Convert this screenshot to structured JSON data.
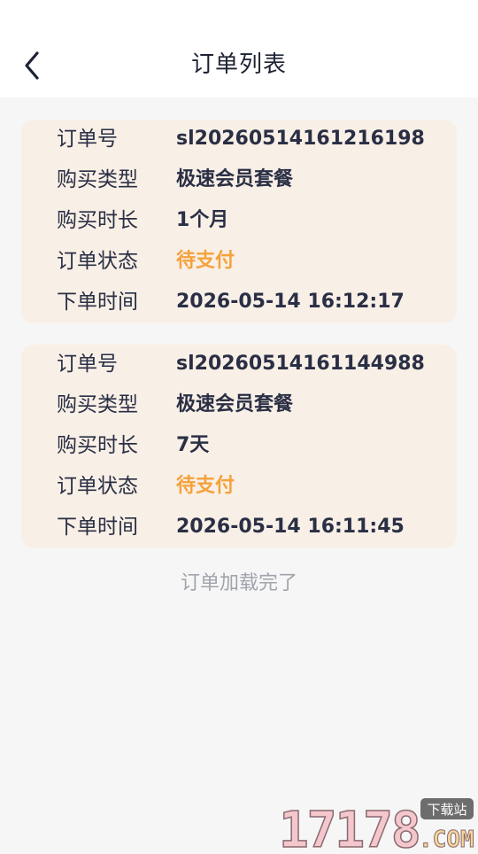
{
  "header": {
    "title": "订单列表"
  },
  "orders": [
    {
      "rows": [
        {
          "label": "订单号",
          "value": "sl20260514161216198"
        },
        {
          "label": "购买类型",
          "value": "极速会员套餐"
        },
        {
          "label": "购买时长",
          "value": "1个月"
        },
        {
          "label": "订单状态",
          "value": "待支付"
        },
        {
          "label": "下单时间",
          "value": "2026-05-14 16:12:17"
        }
      ]
    },
    {
      "rows": [
        {
          "label": "订单号",
          "value": "sl20260514161144988"
        },
        {
          "label": "购买类型",
          "value": "极速会员套餐"
        },
        {
          "label": "购买时长",
          "value": "7天"
        },
        {
          "label": "订单状态",
          "value": "待支付"
        },
        {
          "label": "下单时间",
          "value": "2026-05-14 16:11:45"
        }
      ]
    }
  ],
  "footer": {
    "note": "订单加载完了"
  },
  "watermark": {
    "brand": "17178",
    "suffix": ".COM",
    "tag": "下载站"
  },
  "colors": {
    "status_pending": "#f5a13a",
    "card_bg": "#f8efe6",
    "page_bg": "#f6f6f6"
  },
  "icons": {
    "back": "chevron-left-icon"
  }
}
